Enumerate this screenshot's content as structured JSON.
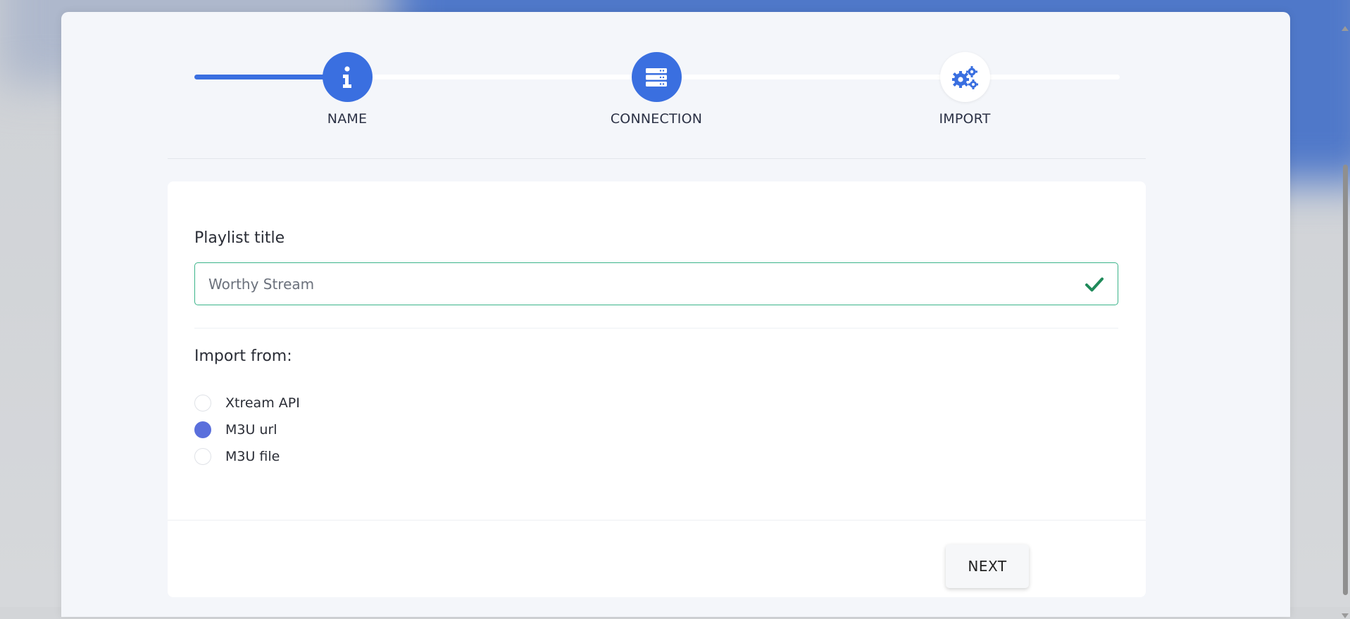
{
  "stepper": {
    "progress_fraction": 0.167,
    "steps": [
      {
        "label": "NAME",
        "icon": "info-icon",
        "state": "active"
      },
      {
        "label": "CONNECTION",
        "icon": "server-icon",
        "state": "active"
      },
      {
        "label": "IMPORT",
        "icon": "gears-icon",
        "state": "inactive"
      }
    ]
  },
  "form": {
    "title_label": "Playlist title",
    "title_value": "Worthy Stream",
    "title_valid": true,
    "import_label": "Import from:",
    "options": [
      {
        "label": "Xtream API",
        "checked": false
      },
      {
        "label": "M3U url",
        "checked": true
      },
      {
        "label": "M3U file",
        "checked": false
      }
    ],
    "next_label": "NEXT"
  },
  "colors": {
    "primary": "#3a6fe0",
    "radio_checked": "#5a6fdc",
    "valid_border": "#3bb48a",
    "valid_check": "#1f8a5a"
  }
}
